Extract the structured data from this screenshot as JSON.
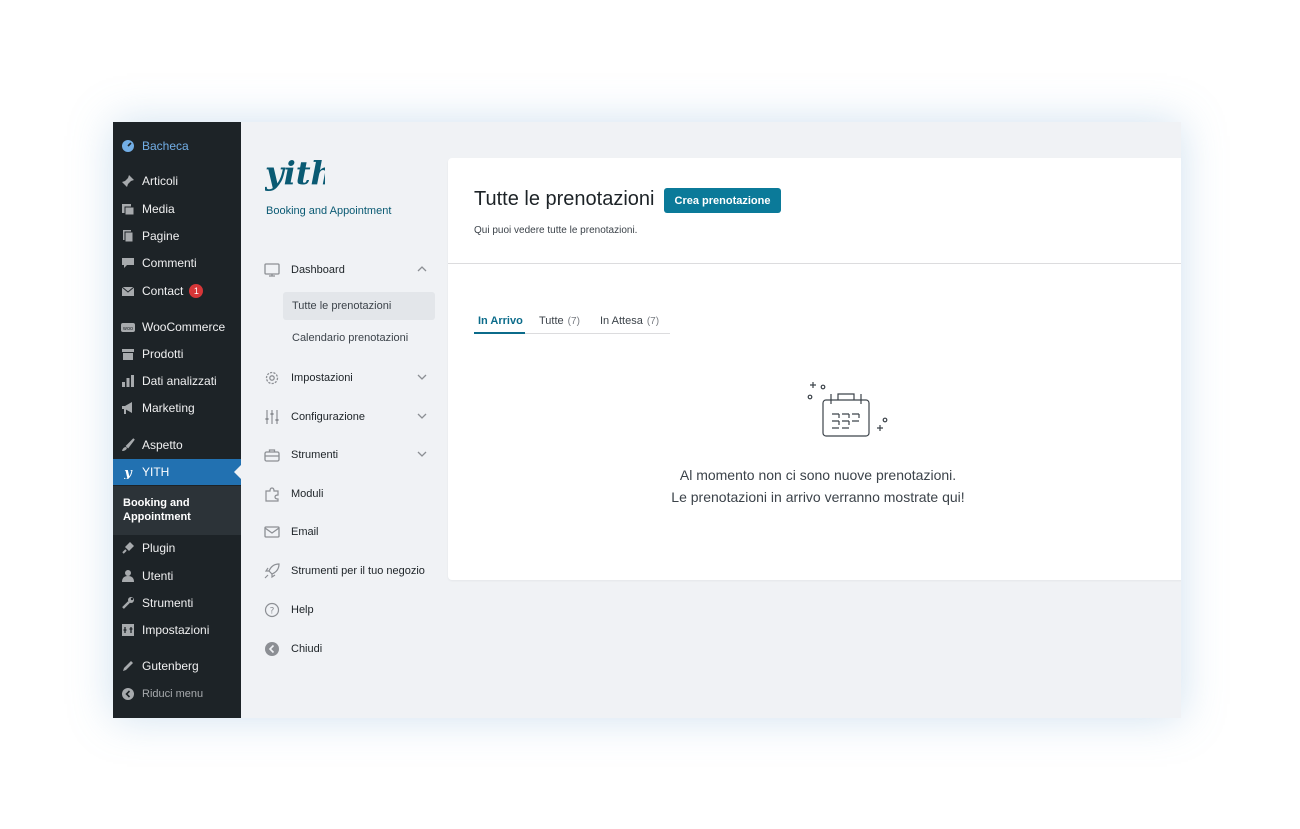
{
  "wp_menu": {
    "bacheca": "Bacheca",
    "articoli": "Articoli",
    "media": "Media",
    "pagine": "Pagine",
    "commenti": "Commenti",
    "contact": "Contact",
    "contact_badge": "1",
    "woocommerce": "WooCommerce",
    "prodotti": "Prodotti",
    "dati": "Dati analizzati",
    "marketing": "Marketing",
    "aspetto": "Aspetto",
    "yith": "YITH",
    "yith_sub": "Booking and Appointment",
    "plugin": "Plugin",
    "utenti": "Utenti",
    "strumenti": "Strumenti",
    "impostazioni": "Impostazioni",
    "gutenberg": "Gutenberg",
    "riduci": "Riduci menu"
  },
  "plugin": {
    "logo_text": "yith",
    "subtitle": "Booking and Appointment",
    "nav": {
      "dashboard": "Dashboard",
      "tutte": "Tutte le prenotazioni",
      "calendario": "Calendario prenotazioni",
      "impostazioni": "Impostazioni",
      "configurazione": "Configurazione",
      "strumenti": "Strumenti",
      "moduli": "Moduli",
      "email": "Email",
      "strumenti_negozio": "Strumenti per il tuo negozio",
      "help": "Help",
      "chiudi": "Chiudi"
    }
  },
  "main": {
    "title": "Tutte le prenotazioni",
    "create_button": "Crea prenotazione",
    "description": "Qui puoi vedere tutte le prenotazioni.",
    "tabs": [
      {
        "label": "In Arrivo",
        "count": ""
      },
      {
        "label": "Tutte",
        "count": "(7)"
      },
      {
        "label": "In Attesa",
        "count": "(7)"
      }
    ],
    "empty_line1": "Al momento non ci sono nuove prenotazioni.",
    "empty_line2": "Le prenotazioni in arrivo verranno mostrate qui!"
  },
  "colors": {
    "accent": "#0b7a99",
    "wp_sidebar": "#1d2327",
    "wp_active": "#2271b1",
    "badge": "#d63638"
  }
}
